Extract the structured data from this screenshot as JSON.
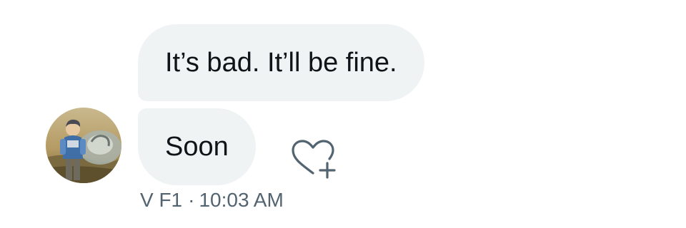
{
  "messages": [
    {
      "text": "It’s bad. It’ll be fine."
    },
    {
      "text": "Soon"
    }
  ],
  "like_icon": "heart-plus-icon",
  "avatar_icon": "avatar-character-illustration",
  "meta": {
    "sender": "V F1",
    "separator": "·",
    "time": "10:03 AM"
  },
  "colors": {
    "bubble_bg": "#eff3f4",
    "text": "#0f1419",
    "meta_text": "#536471",
    "icon": "#536471"
  }
}
